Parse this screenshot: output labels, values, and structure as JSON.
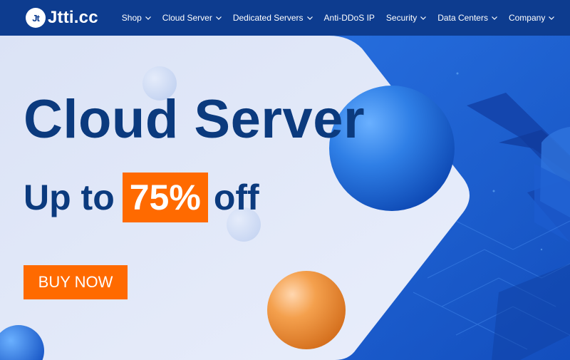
{
  "header": {
    "logo_mark": "Jt",
    "logo_text": "Jtti.cc",
    "nav": [
      {
        "label": "Shop",
        "has_dropdown": true
      },
      {
        "label": "Cloud Server",
        "has_dropdown": true
      },
      {
        "label": "Dedicated Servers",
        "has_dropdown": true
      },
      {
        "label": "Anti-DDoS IP",
        "has_dropdown": false
      },
      {
        "label": "Security",
        "has_dropdown": true
      },
      {
        "label": "Data Centers",
        "has_dropdown": true
      },
      {
        "label": "Company",
        "has_dropdown": true
      }
    ]
  },
  "hero": {
    "title": "Cloud Server",
    "subtitle_prefix": "Up to",
    "discount": "75%",
    "subtitle_suffix": "off",
    "cta_label": "BUY NOW"
  },
  "colors": {
    "nav_bg": "#0d3c8f",
    "accent_orange": "#ff6a00",
    "title_navy": "#0b3a7e",
    "hero_blue": "#1f63d6",
    "panel_bg": "#e2e8f7"
  },
  "icons": {
    "nav_dropdown": "chevron-down-icon"
  }
}
